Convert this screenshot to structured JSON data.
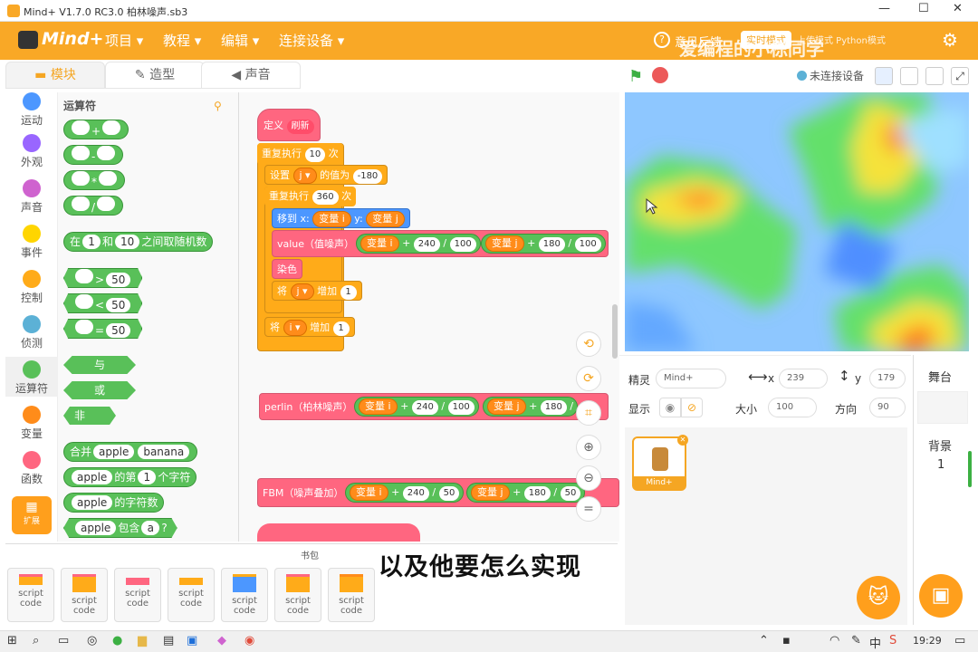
{
  "window": {
    "title": "Mind+ V1.7.0 RC3.0   柏林噪声.sb3",
    "min": "—",
    "max": "☐",
    "close": "✕"
  },
  "menu": {
    "logo": "Mind+",
    "items": [
      "项目",
      "教程",
      "编辑",
      "连接设备"
    ],
    "right_label": "意见反馈",
    "mode_toggle": "实时模式",
    "right_extra": "上传模式  Python模式",
    "watermark": "爱编程的小栋同学"
  },
  "tabs": [
    "模块",
    "造型",
    "声音"
  ],
  "stage_header": {
    "status": "未连接设备"
  },
  "categories": [
    {
      "label": "运动",
      "color": "#4c97ff"
    },
    {
      "label": "外观",
      "color": "#9966ff"
    },
    {
      "label": "声音",
      "color": "#cf63cf"
    },
    {
      "label": "事件",
      "color": "#ffd500"
    },
    {
      "label": "控制",
      "color": "#ffab19"
    },
    {
      "label": "侦测",
      "color": "#5cb1d6"
    },
    {
      "label": "运算符",
      "color": "#59c059"
    },
    {
      "label": "变量",
      "color": "#ff8c1a"
    },
    {
      "label": "函数",
      "color": "#ff6680"
    },
    {
      "label": "扩展",
      "color": "#ff9f1c"
    }
  ],
  "palette": {
    "title": "运算符",
    "ops": [
      "+",
      "-",
      "*",
      "/"
    ],
    "random": {
      "pre": "在",
      "a": "1",
      "mid": "和",
      "b": "10",
      "post": "之间取随机数"
    },
    "cmp": [
      {
        "op": ">",
        "v": "50"
      },
      {
        "op": "<",
        "v": "50"
      },
      {
        "op": "=",
        "v": "50"
      }
    ],
    "logic": [
      "与",
      "或",
      "非"
    ],
    "join": {
      "label": "合并",
      "a": "apple",
      "b": "banana"
    },
    "letter": {
      "a": "apple",
      "mid": "的第",
      "n": "1",
      "post": "个字符"
    },
    "length": {
      "a": "apple",
      "post": "的字符数"
    },
    "contains": {
      "a": "apple",
      "mid": "包含",
      "b": "a",
      "post": "?"
    }
  },
  "script": {
    "define": {
      "label": "定义",
      "name": "刷新"
    },
    "repeat1": {
      "label": "重复执行",
      "n": "10",
      "post": "次"
    },
    "set": {
      "label": "设置",
      "var": "j",
      "mid": "的值为",
      "v": "-180"
    },
    "repeat2": {
      "label": "重复执行",
      "n": "360",
      "post": "次"
    },
    "goto": {
      "label": "移到 x:",
      "x": "变量 i",
      "ylabel": "y:",
      "y": "变量 j"
    },
    "value": {
      "label": "value（值噪声）"
    },
    "color": {
      "label": "染色"
    },
    "incj": {
      "label": "将",
      "var": "j",
      "mid": "增加",
      "v": "1"
    },
    "inci": {
      "label": "将",
      "var": "i",
      "mid": "增加",
      "v": "1"
    },
    "perlin": {
      "label": "perlin（柏林噪声）"
    },
    "fbm": {
      "label": "FBM（噪声叠加）"
    },
    "expr_i": {
      "var": "变量 i",
      "op1": "+",
      "a": "240",
      "op2": "/",
      "b": "100"
    },
    "expr_j": {
      "var": "变量 j",
      "op1": "+",
      "a": "180",
      "op2": "/",
      "b": "100"
    },
    "fbm_i": {
      "var": "变量 i",
      "op1": "+",
      "a": "240",
      "op2": "/",
      "b": "50"
    },
    "fbm_j": {
      "var": "变量 j",
      "op1": "+",
      "a": "180",
      "op2": "/",
      "b": "50"
    }
  },
  "sprite": {
    "label": "精灵",
    "name": "Mind+",
    "x_label": "x",
    "x": "239",
    "y_label": "y",
    "y": "179",
    "show_label": "显示",
    "size_label": "大小",
    "size": "100",
    "dir_label": "方向",
    "dir": "90",
    "thumb_name": "Mind+"
  },
  "stage_col": {
    "label": "舞台",
    "bg_label": "背景",
    "bg_count": "1"
  },
  "bag": {
    "title": "书包",
    "items": [
      "script code",
      "script code",
      "script code",
      "script code",
      "script code",
      "script code",
      "script code"
    ]
  },
  "subtitle": "以及他要怎么实现",
  "taskbar": {
    "time": "19:29",
    "lang": "中"
  }
}
